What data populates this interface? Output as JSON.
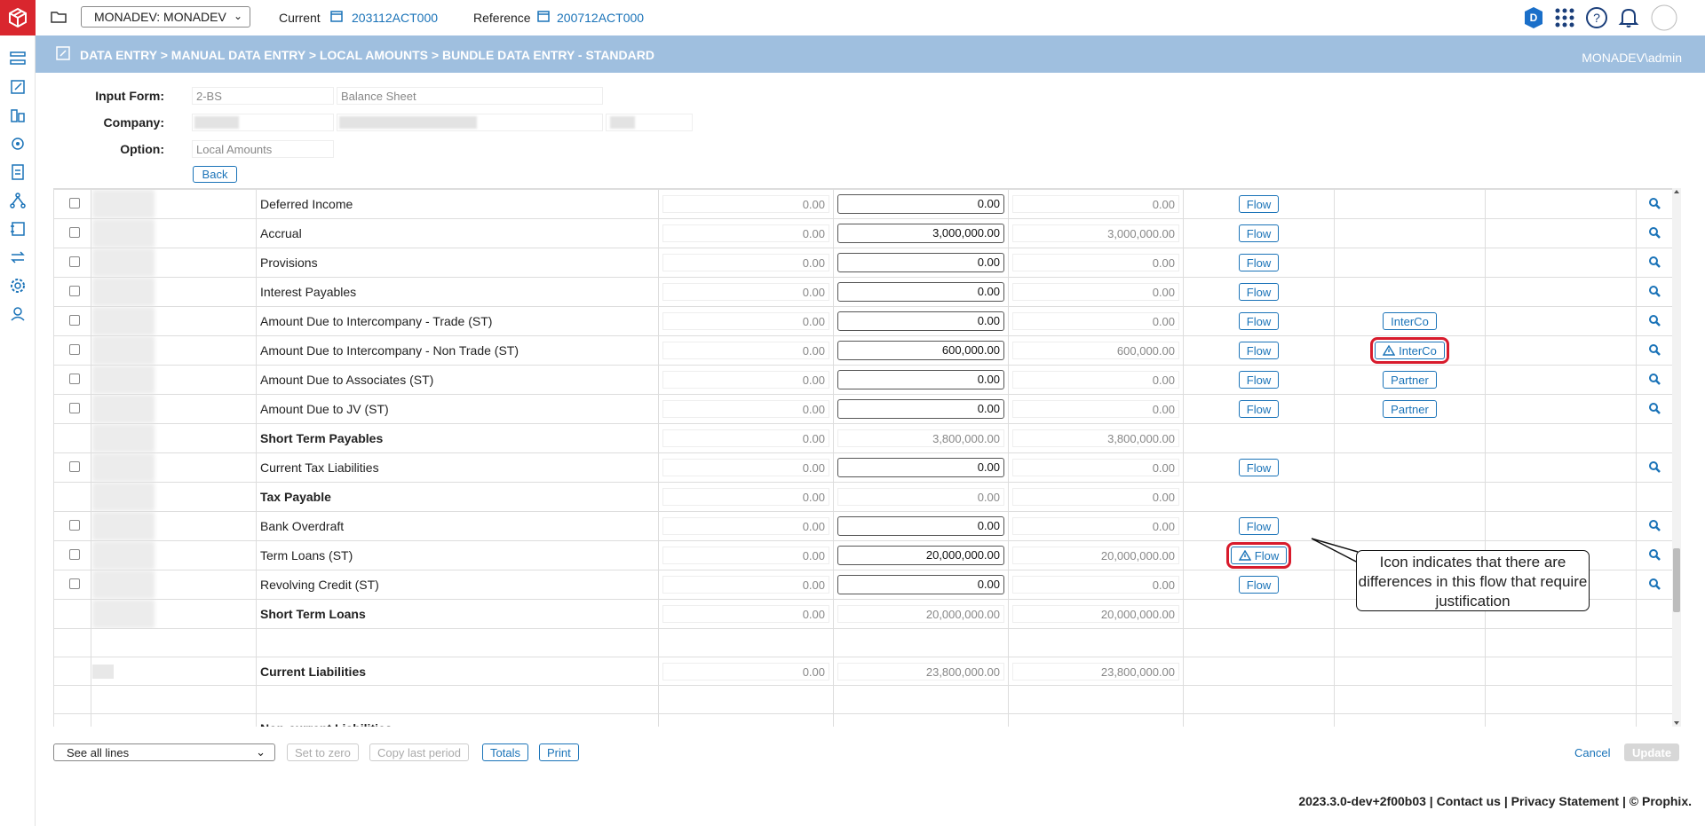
{
  "topbar": {
    "model_select": "MONADEV: MONADEV",
    "current_label": "Current",
    "current_value": "203112ACT000",
    "reference_label": "Reference",
    "reference_value": "200712ACT000",
    "avatar_letter": "D"
  },
  "banner": {
    "breadcrumb": "DATA ENTRY > MANUAL DATA ENTRY > LOCAL AMOUNTS > BUNDLE DATA ENTRY - STANDARD",
    "user": "MONADEV\\admin"
  },
  "form": {
    "input_form_label": "Input Form:",
    "input_form_code": "2-BS",
    "input_form_name": "Balance Sheet",
    "company_label": "Company:",
    "option_label": "Option:",
    "option_value": "Local Amounts",
    "back_label": "Back"
  },
  "rows": [
    {
      "checkbox": true,
      "name": "Deferred Income",
      "c1": "0.00",
      "c2": "0.00",
      "c3": "0.00",
      "flow": "Flow",
      "extra": ""
    },
    {
      "checkbox": true,
      "name": "Accrual",
      "c1": "0.00",
      "c2": "3,000,000.00",
      "c3": "3,000,000.00",
      "flow": "Flow",
      "extra": ""
    },
    {
      "checkbox": true,
      "name": "Provisions",
      "c1": "0.00",
      "c2": "0.00",
      "c3": "0.00",
      "flow": "Flow",
      "extra": ""
    },
    {
      "checkbox": true,
      "name": "Interest Payables",
      "c1": "0.00",
      "c2": "0.00",
      "c3": "0.00",
      "flow": "Flow",
      "extra": ""
    },
    {
      "checkbox": true,
      "name": "Amount Due to Intercompany - Trade (ST)",
      "c1": "0.00",
      "c2": "0.00",
      "c3": "0.00",
      "flow": "Flow",
      "extra": "InterCo"
    },
    {
      "checkbox": true,
      "name": "Amount Due to Intercompany - Non Trade (ST)",
      "c1": "0.00",
      "c2": "600,000.00",
      "c3": "600,000.00",
      "flow": "Flow",
      "extra": "InterCo",
      "extra_warn": true
    },
    {
      "checkbox": true,
      "name": "Amount Due to Associates (ST)",
      "c1": "0.00",
      "c2": "0.00",
      "c3": "0.00",
      "flow": "Flow",
      "extra": "Partner"
    },
    {
      "checkbox": true,
      "name": "Amount Due to JV (ST)",
      "c1": "0.00",
      "c2": "0.00",
      "c3": "0.00",
      "flow": "Flow",
      "extra": "Partner"
    },
    {
      "checkbox": false,
      "name": "Short Term Payables",
      "bold": true,
      "c1": "0.00",
      "c2": "3,800,000.00",
      "c3": "3,800,000.00",
      "flow": "",
      "extra": ""
    },
    {
      "checkbox": true,
      "name": "Current Tax Liabilities",
      "c1": "0.00",
      "c2": "0.00",
      "c3": "0.00",
      "flow": "Flow",
      "extra": ""
    },
    {
      "checkbox": false,
      "name": "Tax Payable",
      "bold": true,
      "c1": "0.00",
      "c2": "0.00",
      "c3": "0.00",
      "flow": "",
      "extra": ""
    },
    {
      "checkbox": true,
      "name": "Bank Overdraft",
      "c1": "0.00",
      "c2": "0.00",
      "c3": "0.00",
      "flow": "Flow",
      "extra": ""
    },
    {
      "checkbox": true,
      "name": "Term Loans (ST)",
      "c1": "0.00",
      "c2": "20,000,000.00",
      "c3": "20,000,000.00",
      "flow": "Flow",
      "flow_warn": true,
      "extra": ""
    },
    {
      "checkbox": true,
      "name": "Revolving Credit (ST)",
      "c1": "0.00",
      "c2": "0.00",
      "c3": "0.00",
      "flow": "Flow",
      "extra": ""
    },
    {
      "checkbox": false,
      "name": "Short Term Loans",
      "bold": true,
      "c1": "0.00",
      "c2": "20,000,000.00",
      "c3": "20,000,000.00",
      "flow": "",
      "extra": ""
    },
    {
      "empty": true
    },
    {
      "checkbox": false,
      "name": "Current Liabilities",
      "bold": true,
      "c1": "0.00",
      "c2": "23,800,000.00",
      "c3": "23,800,000.00",
      "flow": "",
      "extra": ""
    },
    {
      "empty": true
    },
    {
      "checkbox": false,
      "name": "Non-current Liabilities",
      "bold": true,
      "header_only": true
    }
  ],
  "callout": "Icon indicates that there are differences in this flow that require justification",
  "bottom": {
    "lines_select": "See all lines",
    "set_zero": "Set to zero",
    "copy_last": "Copy last period",
    "totals": "Totals",
    "print": "Print",
    "cancel": "Cancel",
    "update": "Update"
  },
  "footer": {
    "version": "2023.3.0-dev+2f00b03",
    "contact": "Contact us",
    "privacy": "Privacy Statement",
    "copyright": "© Prophix."
  }
}
